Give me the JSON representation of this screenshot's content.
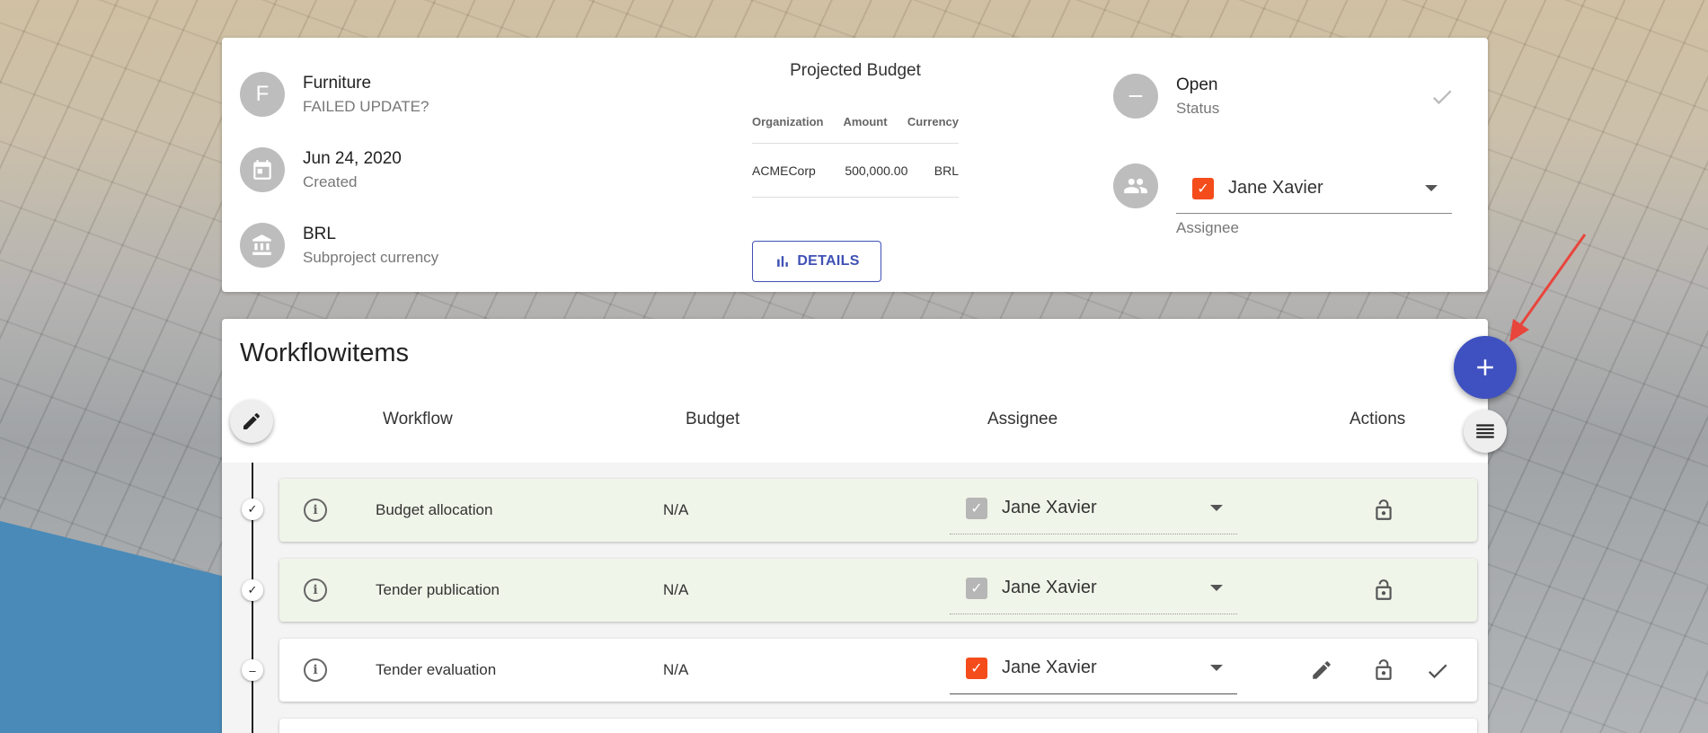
{
  "subproject": {
    "avatar_letter": "F",
    "name": "Furniture",
    "subtitle": "FAILED UPDATE?",
    "created_date": "Jun 24, 2020",
    "created_label": "Created",
    "currency": "BRL",
    "currency_label": "Subproject currency"
  },
  "budget": {
    "title": "Projected Budget",
    "headers": [
      "Organization",
      "Amount",
      "Currency"
    ],
    "rows": [
      {
        "organization": "ACMECorp",
        "amount": "500,000.00",
        "currency": "BRL"
      }
    ],
    "details_label": "DETAILS"
  },
  "status": {
    "value": "Open",
    "label": "Status"
  },
  "assignee": {
    "name": "Jane Xavier",
    "label": "Assignee"
  },
  "workflow": {
    "title": "Workflowitems",
    "columns": [
      "Workflow",
      "Budget",
      "Assignee",
      "Actions"
    ],
    "items": [
      {
        "name": "Budget allocation",
        "budget": "N/A",
        "assignee": "Jane Xavier",
        "state": "closed"
      },
      {
        "name": "Tender publication",
        "budget": "N/A",
        "assignee": "Jane Xavier",
        "state": "closed"
      },
      {
        "name": "Tender evaluation",
        "budget": "N/A",
        "assignee": "Jane Xavier",
        "state": "open"
      }
    ]
  },
  "colors": {
    "primary": "#3f51c0",
    "checkbox_active": "#f44c1b",
    "checkbox_inactive": "#b6b6b6",
    "closed_row_bg": "#f0f5e9",
    "annotation_arrow": "#e8453c"
  },
  "icons": {
    "add_fab": "plus-icon",
    "edit_fab": "pencil-icon",
    "sort_fab": "reorder-icon",
    "details": "bar-chart-icon"
  }
}
